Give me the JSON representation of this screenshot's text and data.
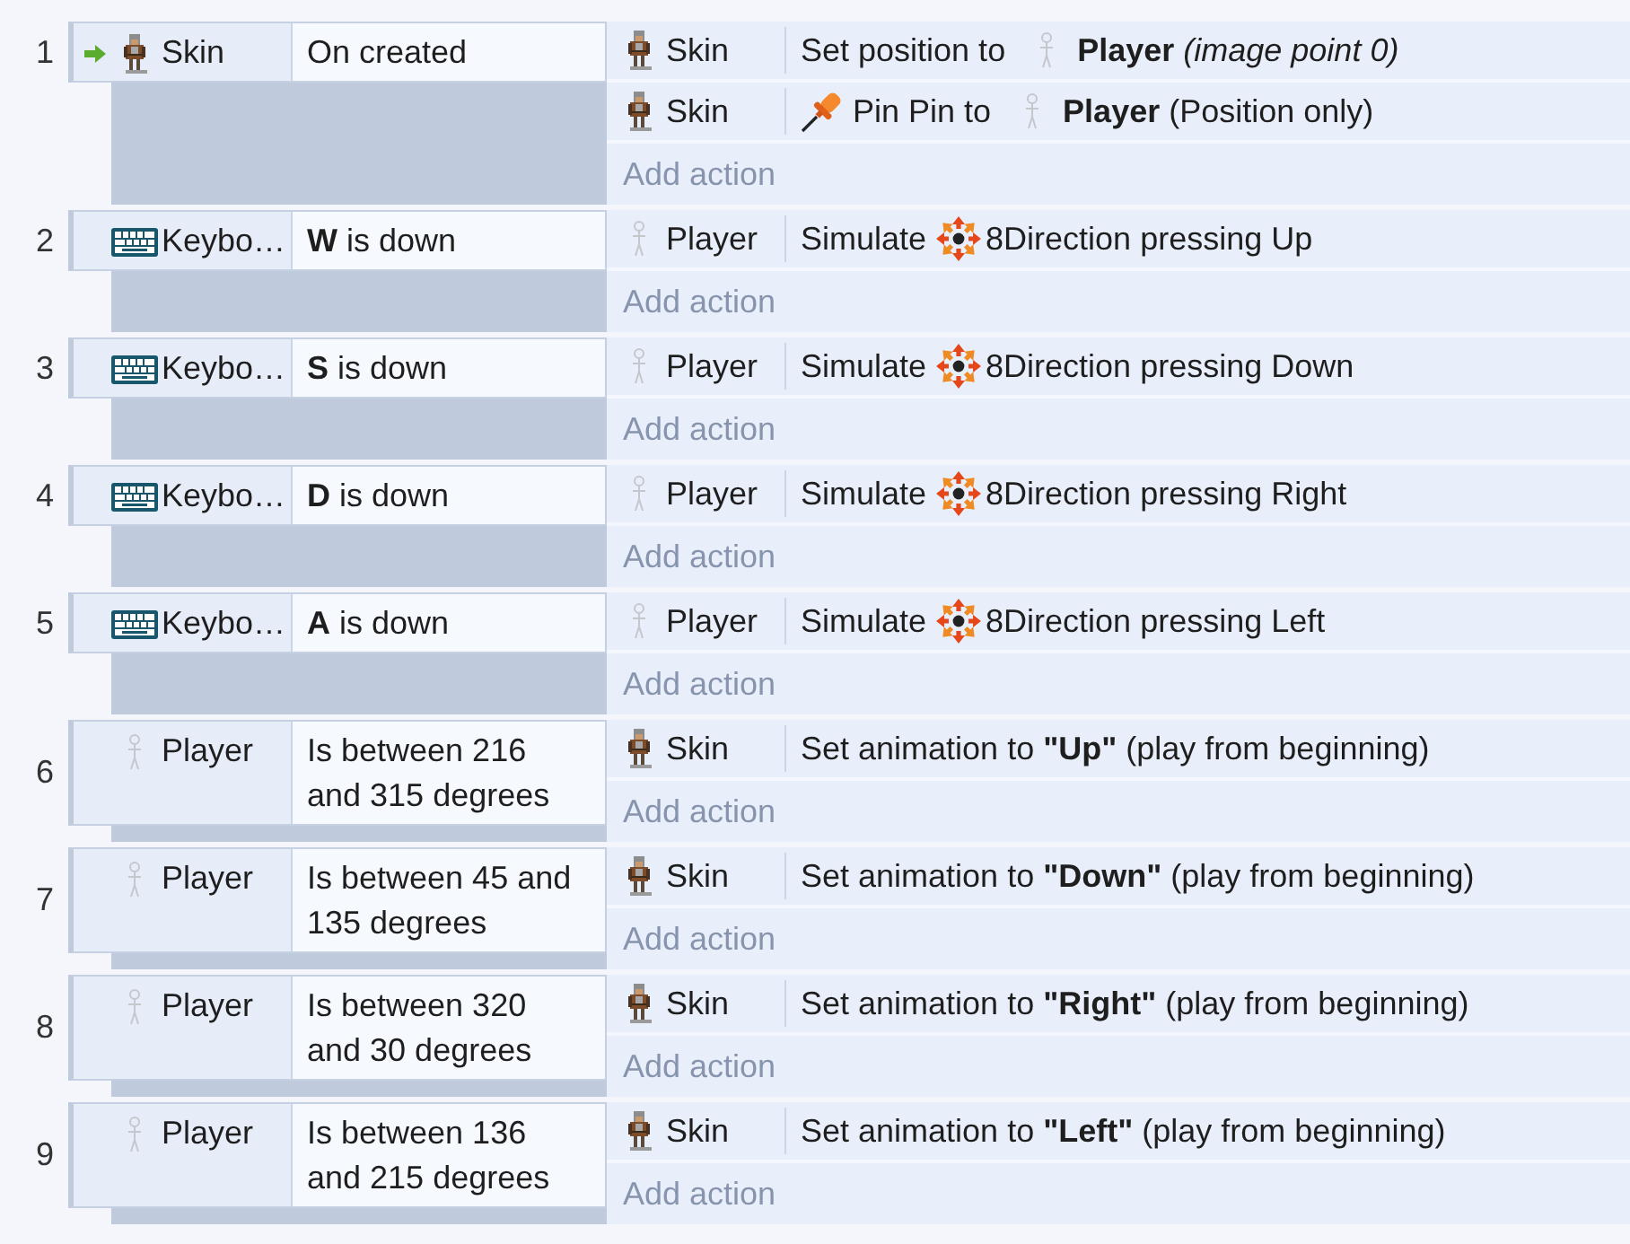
{
  "events": [
    {
      "number": "1",
      "conditions": [
        {
          "trigger": true,
          "object": {
            "kind": "skin",
            "name": "Skin"
          },
          "text": "On created"
        }
      ],
      "actions": [
        {
          "object": {
            "kind": "skin",
            "name": "Skin"
          },
          "parts": [
            {
              "kind": "text",
              "text": "Set position to"
            },
            {
              "kind": "player",
              "text": "**Player** *(image point 0)*"
            }
          ]
        },
        {
          "object": {
            "kind": "skin",
            "name": "Skin"
          },
          "parts": [
            {
              "kind": "pin",
              "text": "Pin Pin to"
            },
            {
              "kind": "player",
              "text": "**Player** (Position only)"
            }
          ]
        }
      ],
      "add_action": "Add action"
    },
    {
      "number": "2",
      "conditions": [
        {
          "trigger": false,
          "object": {
            "kind": "keyboard",
            "name": "Keybo…"
          },
          "text": "**W** is down"
        }
      ],
      "actions": [
        {
          "object": {
            "kind": "player",
            "name": "Player"
          },
          "parts": [
            {
              "kind": "text",
              "text": "Simulate"
            },
            {
              "kind": "movement",
              "text": "8Direction pressing Up"
            }
          ]
        }
      ],
      "add_action": "Add action"
    },
    {
      "number": "3",
      "conditions": [
        {
          "trigger": false,
          "object": {
            "kind": "keyboard",
            "name": "Keybo…"
          },
          "text": "**S** is down"
        }
      ],
      "actions": [
        {
          "object": {
            "kind": "player",
            "name": "Player"
          },
          "parts": [
            {
              "kind": "text",
              "text": "Simulate"
            },
            {
              "kind": "movement",
              "text": "8Direction pressing Down"
            }
          ]
        }
      ],
      "add_action": "Add action"
    },
    {
      "number": "4",
      "conditions": [
        {
          "trigger": false,
          "object": {
            "kind": "keyboard",
            "name": "Keybo…"
          },
          "text": "**D** is down"
        }
      ],
      "actions": [
        {
          "object": {
            "kind": "player",
            "name": "Player"
          },
          "parts": [
            {
              "kind": "text",
              "text": "Simulate"
            },
            {
              "kind": "movement",
              "text": "8Direction pressing Right"
            }
          ]
        }
      ],
      "add_action": "Add action"
    },
    {
      "number": "5",
      "conditions": [
        {
          "trigger": false,
          "object": {
            "kind": "keyboard",
            "name": "Keybo…"
          },
          "text": "**A** is down"
        }
      ],
      "actions": [
        {
          "object": {
            "kind": "player",
            "name": "Player"
          },
          "parts": [
            {
              "kind": "text",
              "text": "Simulate"
            },
            {
              "kind": "movement",
              "text": "8Direction pressing Left"
            }
          ]
        }
      ],
      "add_action": "Add action"
    },
    {
      "number": "6",
      "conditions": [
        {
          "trigger": false,
          "object": {
            "kind": "player",
            "name": "Player"
          },
          "text": "Is between 216 and 315 degrees"
        }
      ],
      "actions": [
        {
          "object": {
            "kind": "skin",
            "name": "Skin"
          },
          "parts": [
            {
              "kind": "text",
              "text": "Set animation to **\"Up\"** (play from beginning)"
            }
          ]
        }
      ],
      "add_action": "Add action"
    },
    {
      "number": "7",
      "conditions": [
        {
          "trigger": false,
          "object": {
            "kind": "player",
            "name": "Player"
          },
          "text": "Is between 45 and 135 degrees"
        }
      ],
      "actions": [
        {
          "object": {
            "kind": "skin",
            "name": "Skin"
          },
          "parts": [
            {
              "kind": "text",
              "text": "Set animation to **\"Down\"** (play from beginning)"
            }
          ]
        }
      ],
      "add_action": "Add action"
    },
    {
      "number": "8",
      "conditions": [
        {
          "trigger": false,
          "object": {
            "kind": "player",
            "name": "Player"
          },
          "text": "Is between 320 and 30 degrees"
        }
      ],
      "actions": [
        {
          "object": {
            "kind": "skin",
            "name": "Skin"
          },
          "parts": [
            {
              "kind": "text",
              "text": "Set animation to **\"Right\"** (play from beginning)"
            }
          ]
        }
      ],
      "add_action": "Add action"
    },
    {
      "number": "9",
      "conditions": [
        {
          "trigger": false,
          "object": {
            "kind": "player",
            "name": "Player"
          },
          "text": "Is between 136 and 215 degrees"
        }
      ],
      "actions": [
        {
          "object": {
            "kind": "skin",
            "name": "Skin"
          },
          "parts": [
            {
              "kind": "text",
              "text": "Set animation to **\"Left\"** (play from beginning)"
            }
          ]
        }
      ],
      "add_action": "Add action"
    }
  ]
}
